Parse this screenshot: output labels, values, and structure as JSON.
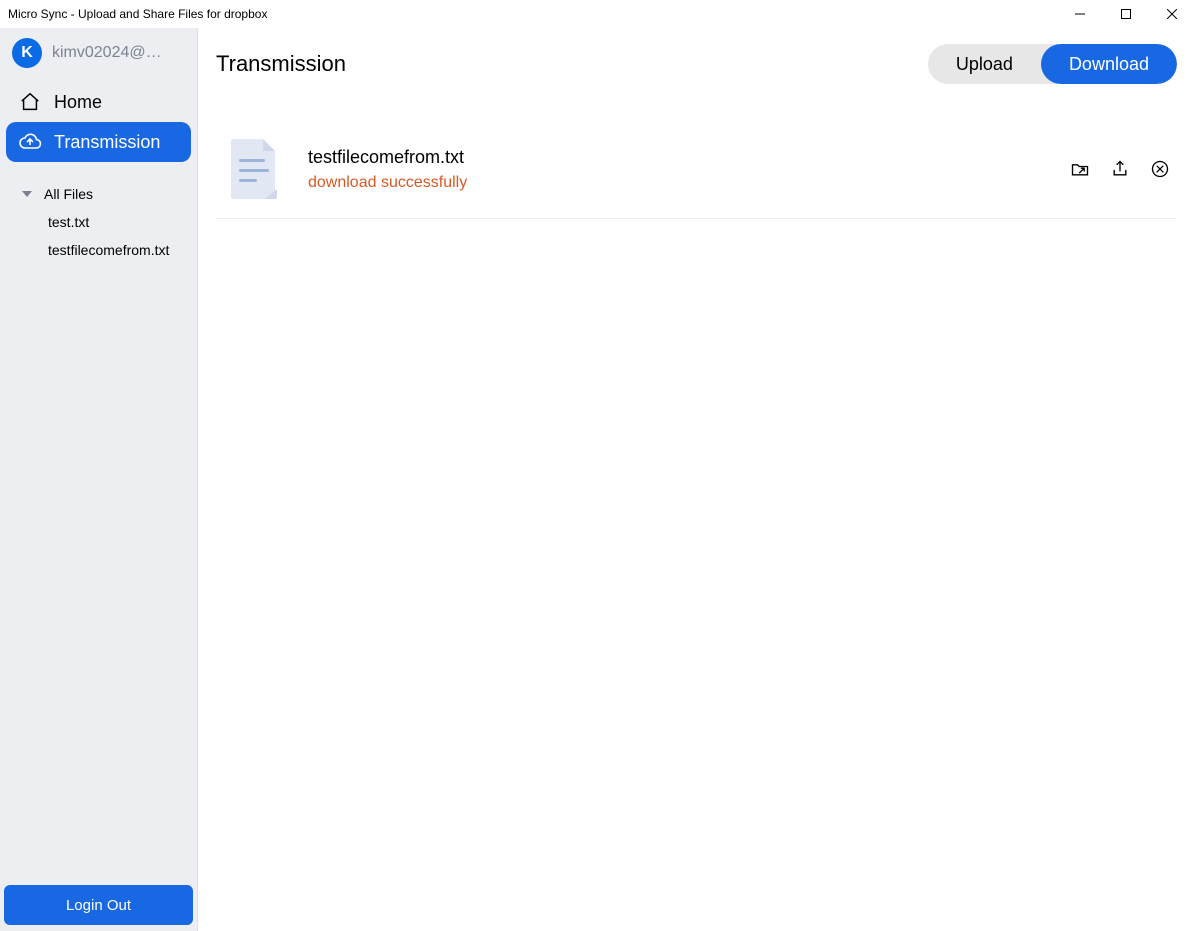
{
  "window": {
    "title": "Micro Sync - Upload and Share Files for dropbox"
  },
  "account": {
    "avatar_letter": "K",
    "email_display": "kimv02024@…"
  },
  "nav": {
    "home_label": "Home",
    "transmission_label": "Transmission"
  },
  "tree": {
    "root_label": "All Files",
    "files": [
      "test.txt",
      "testfilecomefrom.txt"
    ]
  },
  "logout_label": "Login Out",
  "page": {
    "title": "Transmission",
    "upload_label": "Upload",
    "download_label": "Download"
  },
  "transfers": [
    {
      "name": "testfilecomefrom.txt",
      "status": "download successfully"
    }
  ]
}
